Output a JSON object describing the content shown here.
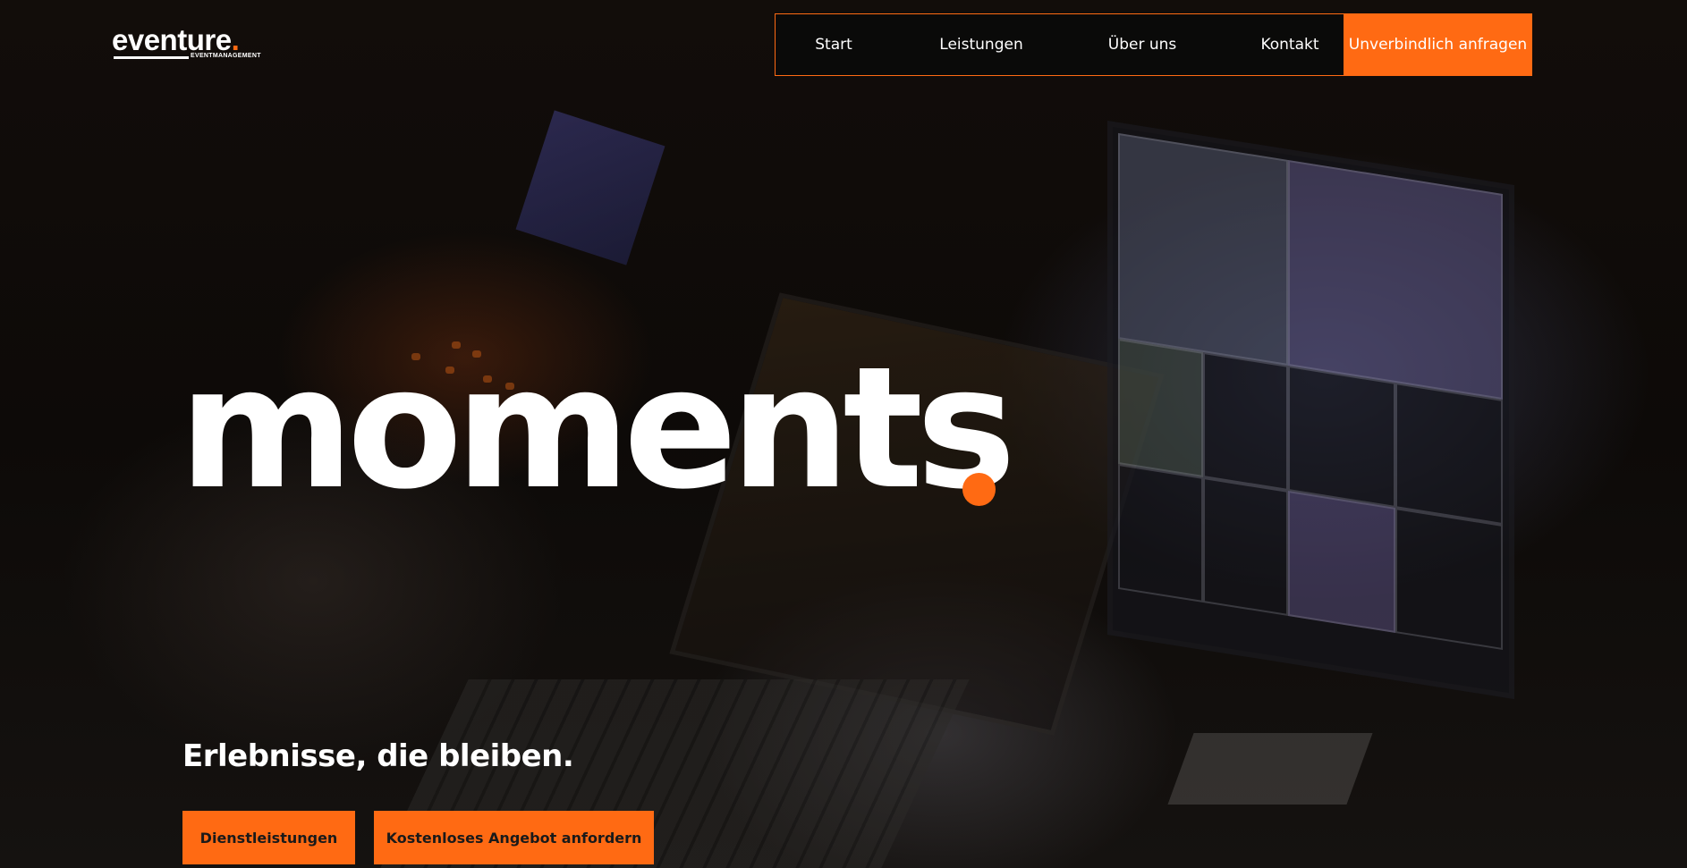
{
  "brand": {
    "name": "eventure",
    "dot": ".",
    "tagline": "EVENTMANAGEMENT",
    "accent_color": "#ff6a13"
  },
  "nav": {
    "items": [
      {
        "label": "Start"
      },
      {
        "label": "Leistungen"
      },
      {
        "label": "Über uns"
      },
      {
        "label": "Kontakt"
      }
    ],
    "cta_label": "Unverbindlich anfragen"
  },
  "hero": {
    "headline": "moments",
    "subheadline": "Erlebnisse, die bleiben.",
    "buttons": {
      "services": "Dienstleistungen",
      "quote": "Kostenloses Angebot anfordern"
    }
  }
}
